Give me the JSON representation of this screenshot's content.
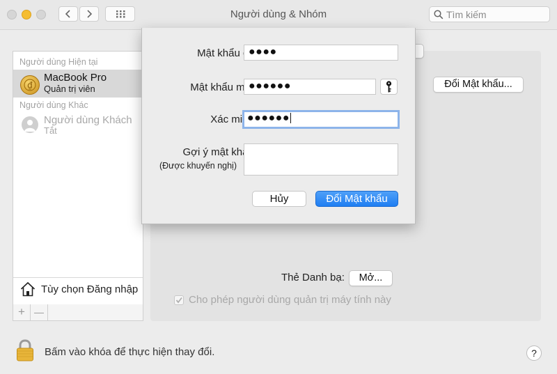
{
  "window": {
    "title": "Người dùng & Nhóm"
  },
  "toolbar": {
    "back_icon": "chevron-left-icon",
    "forward_icon": "chevron-right-icon",
    "grid_icon": "grid-icon",
    "search_placeholder": "Tìm kiếm"
  },
  "sidebar": {
    "current_users_label": "Người dùng Hiện tại",
    "current_user": {
      "name": "MacBook Pro",
      "role": "Quản trị viên"
    },
    "other_users_label": "Người dùng Khác",
    "guest_user": {
      "name": "Người dùng Khách",
      "status": "Tắt"
    },
    "login_options_label": "Tùy chọn Đăng nhập",
    "add_label": "+",
    "remove_label": "—"
  },
  "main": {
    "change_password_label": "Đổi Mật khẩu...",
    "contacts_label": "Thẻ Danh bạ:",
    "open_label": "Mở...",
    "allow_admin_label": "Cho phép người dùng quản trị máy tính này",
    "allow_admin_checked": true
  },
  "sheet": {
    "old_password_label": "Mật khẩu cũ:",
    "old_password_value": "●●●●",
    "new_password_label": "Mật khẩu mới:",
    "new_password_value": "●●●●●●",
    "verify_label": "Xác minh:",
    "verify_value": "●●●●●●",
    "hint_label": "Gợi ý mật khẩu:",
    "hint_sublabel": "(Được khuyến nghị)",
    "hint_value": "",
    "cancel_label": "Hủy",
    "confirm_label": "Đổi Mật khẩu"
  },
  "footer": {
    "lock_text": "Bấm vào khóa để thực hiện thay đổi.",
    "help_label": "?"
  },
  "colors": {
    "primary_button": "#1f7ef2",
    "lock": "#e8b53a",
    "selection": "#d8d8d8",
    "focus_ring": "#8db4ea"
  }
}
